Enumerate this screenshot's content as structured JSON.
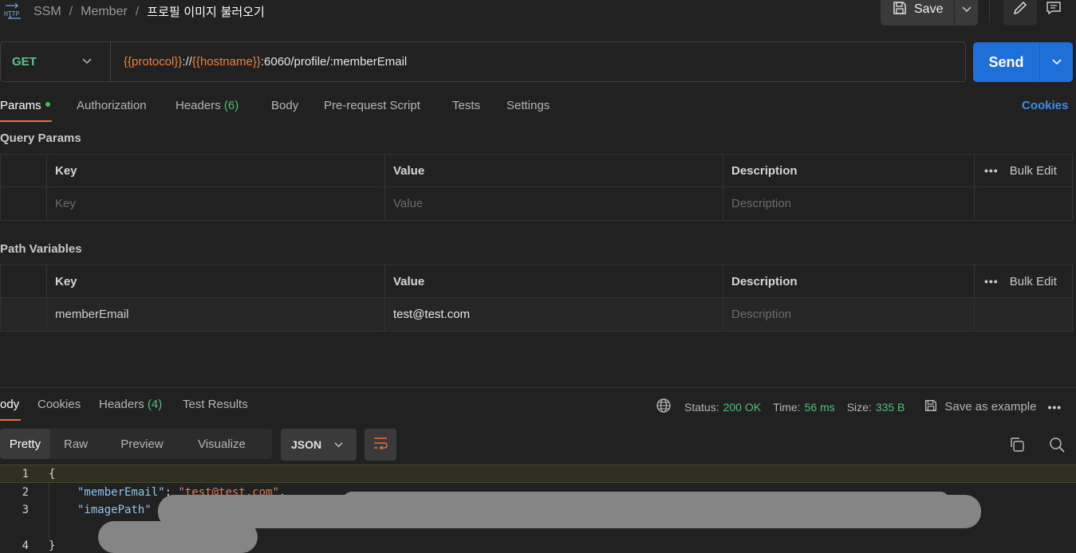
{
  "breadcrumb": {
    "items": [
      "SSM",
      "Member"
    ],
    "separator": "/",
    "current": "프로필 이미지 불러오기"
  },
  "toolbar": {
    "save_label": "Save"
  },
  "request": {
    "method": "GET",
    "url_parts": [
      {
        "text": "{{protocol}}",
        "kind": "var"
      },
      {
        "text": "://",
        "kind": "plain"
      },
      {
        "text": "{{hostname}}",
        "kind": "var"
      },
      {
        "text": ":6060/profile/:memberEmail",
        "kind": "plain"
      }
    ],
    "send_label": "Send"
  },
  "request_tabs": {
    "params": "Params",
    "authorization": "Authorization",
    "headers": "Headers",
    "headers_count": "(6)",
    "body": "Body",
    "pre_request": "Pre-request Script",
    "tests": "Tests",
    "settings": "Settings",
    "cookies": "Cookies"
  },
  "query_params": {
    "title": "Query Params",
    "columns": [
      "Key",
      "Value",
      "Description"
    ],
    "bulk_edit": "Bulk Edit",
    "placeholders": {
      "key": "Key",
      "value": "Value",
      "description": "Description"
    }
  },
  "path_variables": {
    "title": "Path Variables",
    "columns": [
      "Key",
      "Value",
      "Description"
    ],
    "bulk_edit": "Bulk Edit",
    "rows": [
      {
        "key": "memberEmail",
        "value": "test@test.com",
        "description_placeholder": "Description"
      }
    ]
  },
  "response": {
    "tabs": {
      "body": "ody",
      "cookies": "Cookies",
      "headers": "Headers",
      "headers_count": "(4)",
      "test_results": "Test Results"
    },
    "status_label": "Status:",
    "status_value": "200 OK",
    "time_label": "Time:",
    "time_value": "56 ms",
    "size_label": "Size:",
    "size_value": "335 B",
    "save_example": "Save as example",
    "format_tabs": [
      "Pretty",
      "Raw",
      "Preview",
      "Visualize"
    ],
    "format_selected": "JSON",
    "code": {
      "line_numbers": [
        "1",
        "2",
        "3",
        "4"
      ],
      "open_brace": "{",
      "close_brace": "}",
      "line2_key": "\"memberEmail\"",
      "line2_value": "\"test@test.com\"",
      "line3_key": "\"imagePath\""
    }
  },
  "colors": {
    "accent_orange": "#f26b3a",
    "send_blue": "#1f6fd8",
    "method_green": "#5cc48a",
    "variable_orange": "#f0803c",
    "status_green": "#4ec27a"
  },
  "icons": [
    "http-icon",
    "save-icon",
    "chevron-down-icon",
    "pencil-icon",
    "comment-icon",
    "globe-icon",
    "copy-icon",
    "search-icon",
    "wrap-icon",
    "more-icon"
  ]
}
